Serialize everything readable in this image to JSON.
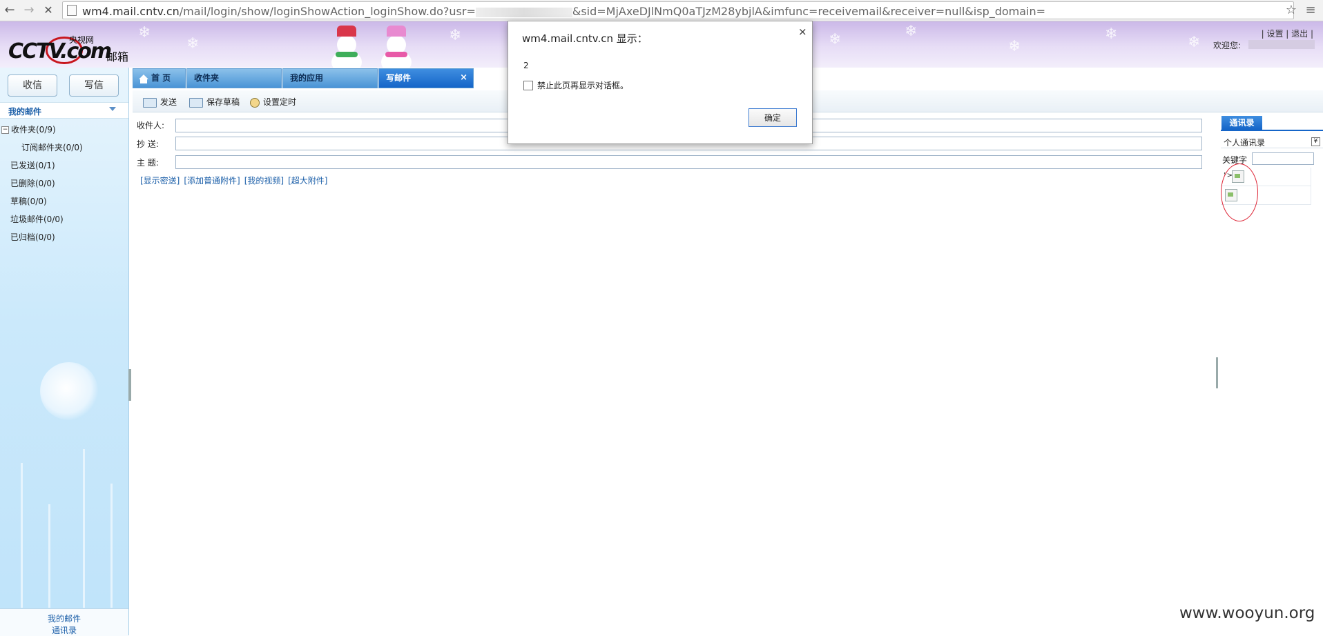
{
  "browser": {
    "url_host": "wm4.mail.cntv.cn",
    "url_path_before": "/mail/login/show/loginShowAction_loginShow.do?usr=",
    "url_path_after": "&sid=MjAxeDJlNmQ0aTJzM28ybjlA&imfunc=receivemail&receiver=null&isp_domain="
  },
  "header": {
    "logo_text": "CCTV.com",
    "logo_sub": "央视网",
    "logo_mail": "邮箱",
    "top_links": "| 设置 | 退出 |",
    "welcome": "欢迎您:"
  },
  "sidebar": {
    "receive_label": "收信",
    "compose_label": "写信",
    "my_mail": "我的邮件",
    "folders": [
      "收件夹(0/9)",
      "订阅邮件夹(0/0)",
      "已发送(0/1)",
      "已删除(0/0)",
      "草稿(0/0)",
      "垃圾邮件(0/0)",
      "已归档(0/0)"
    ],
    "footer_1": "我的邮件",
    "footer_2": "通讯录"
  },
  "tabs": [
    {
      "label": "首 页"
    },
    {
      "label": "收件夹"
    },
    {
      "label": "我的应用"
    },
    {
      "label": "写邮件",
      "close": "×"
    }
  ],
  "toolbar": {
    "send": "发送",
    "save_draft": "保存草稿",
    "schedule": "设置定时"
  },
  "compose": {
    "to_label": "收件人:",
    "cc_label": "抄 送:",
    "subject_label": "主 题:",
    "links": [
      "[显示密送]",
      "[添加普通附件]",
      "[我的视频]",
      "[超大附件]"
    ]
  },
  "address_book": {
    "tab": "通讯录",
    "select_value": "个人通讯录",
    "keyword_label": "关键字",
    "row_prefix": "\">"
  },
  "dialog": {
    "title": "wm4.mail.cntv.cn 显示：",
    "close": "×",
    "message": "2",
    "checkbox_label": "禁止此页再显示对话框。",
    "ok_label": "确定"
  },
  "watermark": "www.wooyun.org"
}
